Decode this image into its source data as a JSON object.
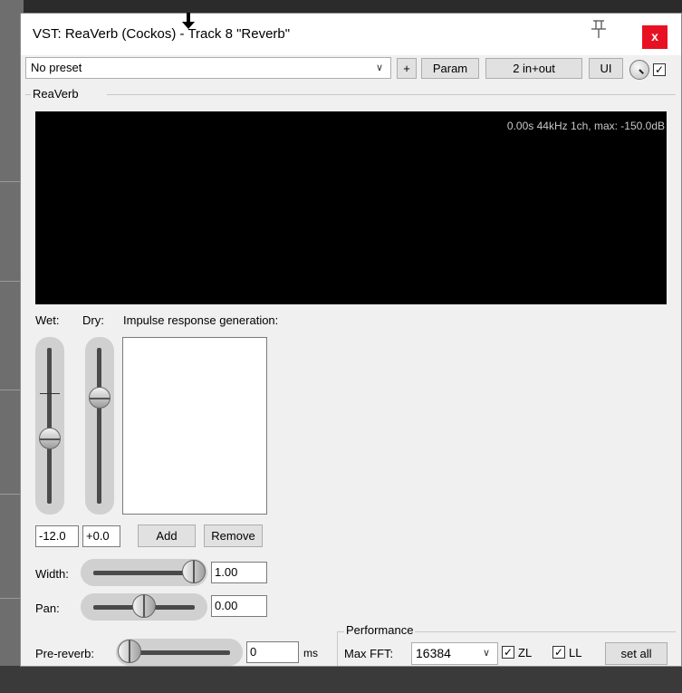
{
  "window": {
    "title": "VST: ReaVerb (Cockos) - Track 8 \"Reverb\"",
    "close_label": "x"
  },
  "toolbar": {
    "preset_value": "No preset",
    "plus_label": "+",
    "param_label": "Param",
    "io_label": "2 in+out",
    "ui_label": "UI"
  },
  "plugin_group_label": "ReaVerb",
  "display": {
    "info": "0.00s 44kHz 1ch, max: -150.0dB"
  },
  "controls": {
    "wet_label": "Wet:",
    "dry_label": "Dry:",
    "ir_label": "Impulse response generation:",
    "wet_value": "-12.0",
    "dry_value": "+0.0",
    "add_label": "Add",
    "remove_label": "Remove",
    "width_label": "Width:",
    "width_value": "1.00",
    "pan_label": "Pan:",
    "pan_value": "0.00",
    "prereverb_label": "Pre-reverb:",
    "prereverb_value": "0",
    "prereverb_unit": "ms"
  },
  "performance": {
    "group_label": "Performance",
    "max_fft_label": "Max FFT:",
    "max_fft_value": "16384",
    "zl_label": "ZL",
    "zl_checked": true,
    "ll_label": "LL",
    "ll_checked": true,
    "set_all_label": "set all"
  },
  "slider_levels": {
    "wet": 0.41,
    "dry": 0.7,
    "width": 1.0,
    "pan": 0.5,
    "prereverb": 0.0
  },
  "icons": [
    "pin-icon",
    "chevron-down-icon",
    "knob-icon",
    "checkmark-icon",
    "cursor-arrow-icon"
  ]
}
